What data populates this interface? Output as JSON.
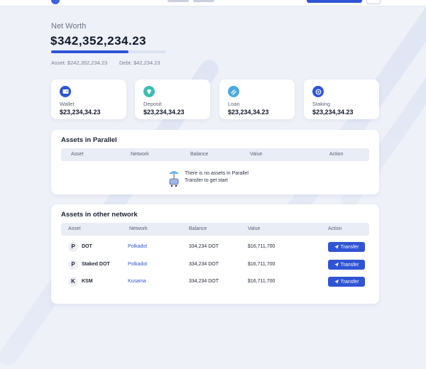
{
  "header": {},
  "net_worth": {
    "label": "Net Worth",
    "value": "$342,352,234.23",
    "asset_text": "Asset: $242,352,234.23",
    "debt_text": "Debt: $42,234.23",
    "asset_ratio": 0.67
  },
  "stats": [
    {
      "label": "Wallet",
      "value": "$23,234,34.23",
      "icon": "wallet-icon",
      "color": "#2f55d4"
    },
    {
      "label": "Deposit",
      "value": "$23,234,34.23",
      "icon": "deposit-icon",
      "color": "#3fbcb0"
    },
    {
      "label": "Loan",
      "value": "$23,234,34.23",
      "icon": "loan-icon",
      "color": "#4aa9e0"
    },
    {
      "label": "Staking",
      "value": "$23,234,34.23",
      "icon": "staking-icon",
      "color": "#2f55d4"
    }
  ],
  "parallel": {
    "title": "Assets in Parallel",
    "columns": [
      "Asset",
      "Network",
      "Balance",
      "Value",
      "Action"
    ],
    "empty_line1": "There is no assets in Parallel",
    "empty_line2": "Transfer to get start"
  },
  "other": {
    "title": "Assets in other network",
    "columns": [
      "Asset",
      "Network",
      "Balance",
      "Value",
      "Action"
    ],
    "rows": [
      {
        "asset": "DOT",
        "network": "Polkadot",
        "balance": "334,234 DOT",
        "value": "$16,711,700",
        "action": "Transfer",
        "icon": "P"
      },
      {
        "asset": "Staked DOT",
        "network": "Polkadot",
        "balance": "334,234 DOT",
        "value": "$16,711,700",
        "action": "Transfer",
        "icon": "P"
      },
      {
        "asset": "KSM",
        "network": "Kusama",
        "balance": "334,234 DOT",
        "value": "$16,711,700",
        "action": "Transfer",
        "icon": "K"
      }
    ]
  }
}
